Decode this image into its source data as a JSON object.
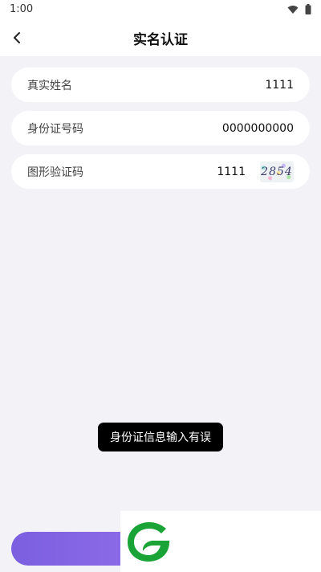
{
  "status_bar": {
    "time": "1:00"
  },
  "header": {
    "title": "实名认证"
  },
  "form": {
    "name": {
      "label": "真实姓名",
      "value": "1111"
    },
    "id_number": {
      "label": "身份证号码",
      "value": "0000000000"
    },
    "captcha": {
      "label": "图形验证码",
      "value": "1111",
      "image_text": "2854"
    }
  },
  "toast": {
    "message": "身份证信息输入有误"
  },
  "colors": {
    "accent_start": "#7b5fe0",
    "accent_end": "#a67cf0",
    "logo_green": "#1aa336"
  }
}
